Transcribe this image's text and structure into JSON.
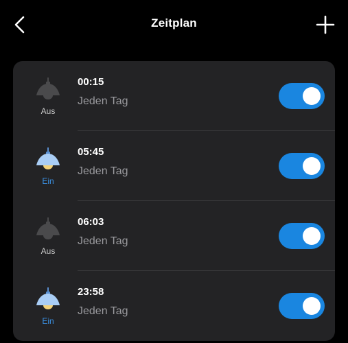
{
  "header": {
    "back_icon": "chevron-left-icon",
    "title": "Zeitplan",
    "add_icon": "plus-icon"
  },
  "colors": {
    "background": "#000000",
    "card": "#232325",
    "toggle_on": "#1a86e0",
    "status_on": "#3a8fe0",
    "lamp_off": "#4a4a4c",
    "lamp_on_shade": "#a9cdf5",
    "lamp_on_bulb": "#f3d27a"
  },
  "schedules": [
    {
      "time": "00:15",
      "repeat": "Jeden Tag",
      "lamp_state": "off",
      "status": "Aus",
      "enabled": true
    },
    {
      "time": "05:45",
      "repeat": "Jeden Tag",
      "lamp_state": "on",
      "status": "Ein",
      "enabled": true
    },
    {
      "time": "06:03",
      "repeat": "Jeden Tag",
      "lamp_state": "off",
      "status": "Aus",
      "enabled": true
    },
    {
      "time": "23:58",
      "repeat": "Jeden Tag",
      "lamp_state": "on",
      "status": "Ein",
      "enabled": true
    }
  ]
}
